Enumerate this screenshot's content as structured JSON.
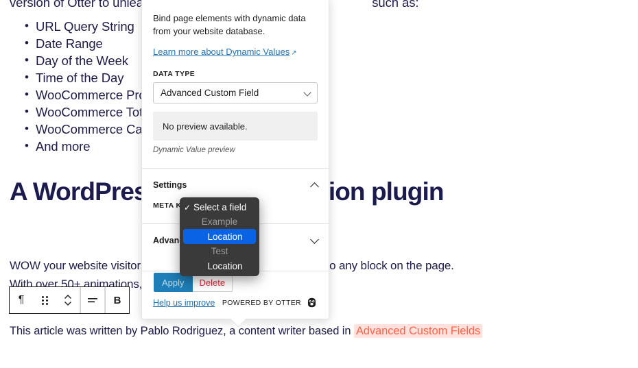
{
  "article": {
    "cut_line_start": "version of Otter to unleash",
    "cut_line_end": "such as:",
    "feature_list": [
      "URL Query String",
      "Date Range",
      "Day of the Week",
      "Time of the Day",
      "WooCommerce Produ",
      "WooCommerce Total",
      "WooCommerce Cart",
      "And more"
    ],
    "heading": "A WordPress blocks animation plugin",
    "body": "WOW your website visitors with animations that can be added to any block on the page. With over 50+ animations, Otter makes it possible to add",
    "byline_prefix": "This article was written by Pablo Rodriguez, a content writer based in ",
    "byline_highlight": "Advanced Custom Fields"
  },
  "block_toolbar": {
    "paragraph_icon": "paragraph-icon",
    "drag_icon": "drag-handle-icon",
    "move_icon": "move-up-down-icon",
    "align_icon": "align-icon",
    "bold_label": "B"
  },
  "popover": {
    "intro": "Bind page elements with dynamic data from your website database.",
    "learn_more": "Learn more about Dynamic Values",
    "external_icon": "external-link-icon",
    "data_type_label": "DATA TYPE",
    "data_type_value": "Advanced Custom Field",
    "preview_text": "No preview available.",
    "preview_caption": "Dynamic Value preview",
    "settings_label": "Settings",
    "settings_state": "expanded",
    "meta_key_label": "META KEY",
    "advanced_label": "Advanced",
    "advanced_state": "collapsed",
    "apply_label": "Apply",
    "delete_label": "Delete",
    "help_label": "Help us improve",
    "powered_by": "POWERED BY OTTER",
    "otter_icon": "otter-logo-icon"
  },
  "dropdown": {
    "check_glyph": "✓",
    "items": [
      {
        "type": "item",
        "label": "Select a field",
        "checked": true
      },
      {
        "type": "group",
        "label": "Example"
      },
      {
        "type": "option",
        "label": "Location",
        "selected": true
      },
      {
        "type": "group",
        "label": "Test"
      },
      {
        "type": "option",
        "label": "Location",
        "selected": false
      }
    ]
  },
  "colors": {
    "accent_blue": "#0a63e4",
    "link_blue": "#2271b1",
    "apply_blue": "#1e7fb8",
    "delete_red": "#e0273a",
    "highlight_bg": "#ffe2dd",
    "highlight_text": "#ff6347",
    "menu_bg": "#3a3a3a",
    "text_navy": "#1e1b4b"
  }
}
